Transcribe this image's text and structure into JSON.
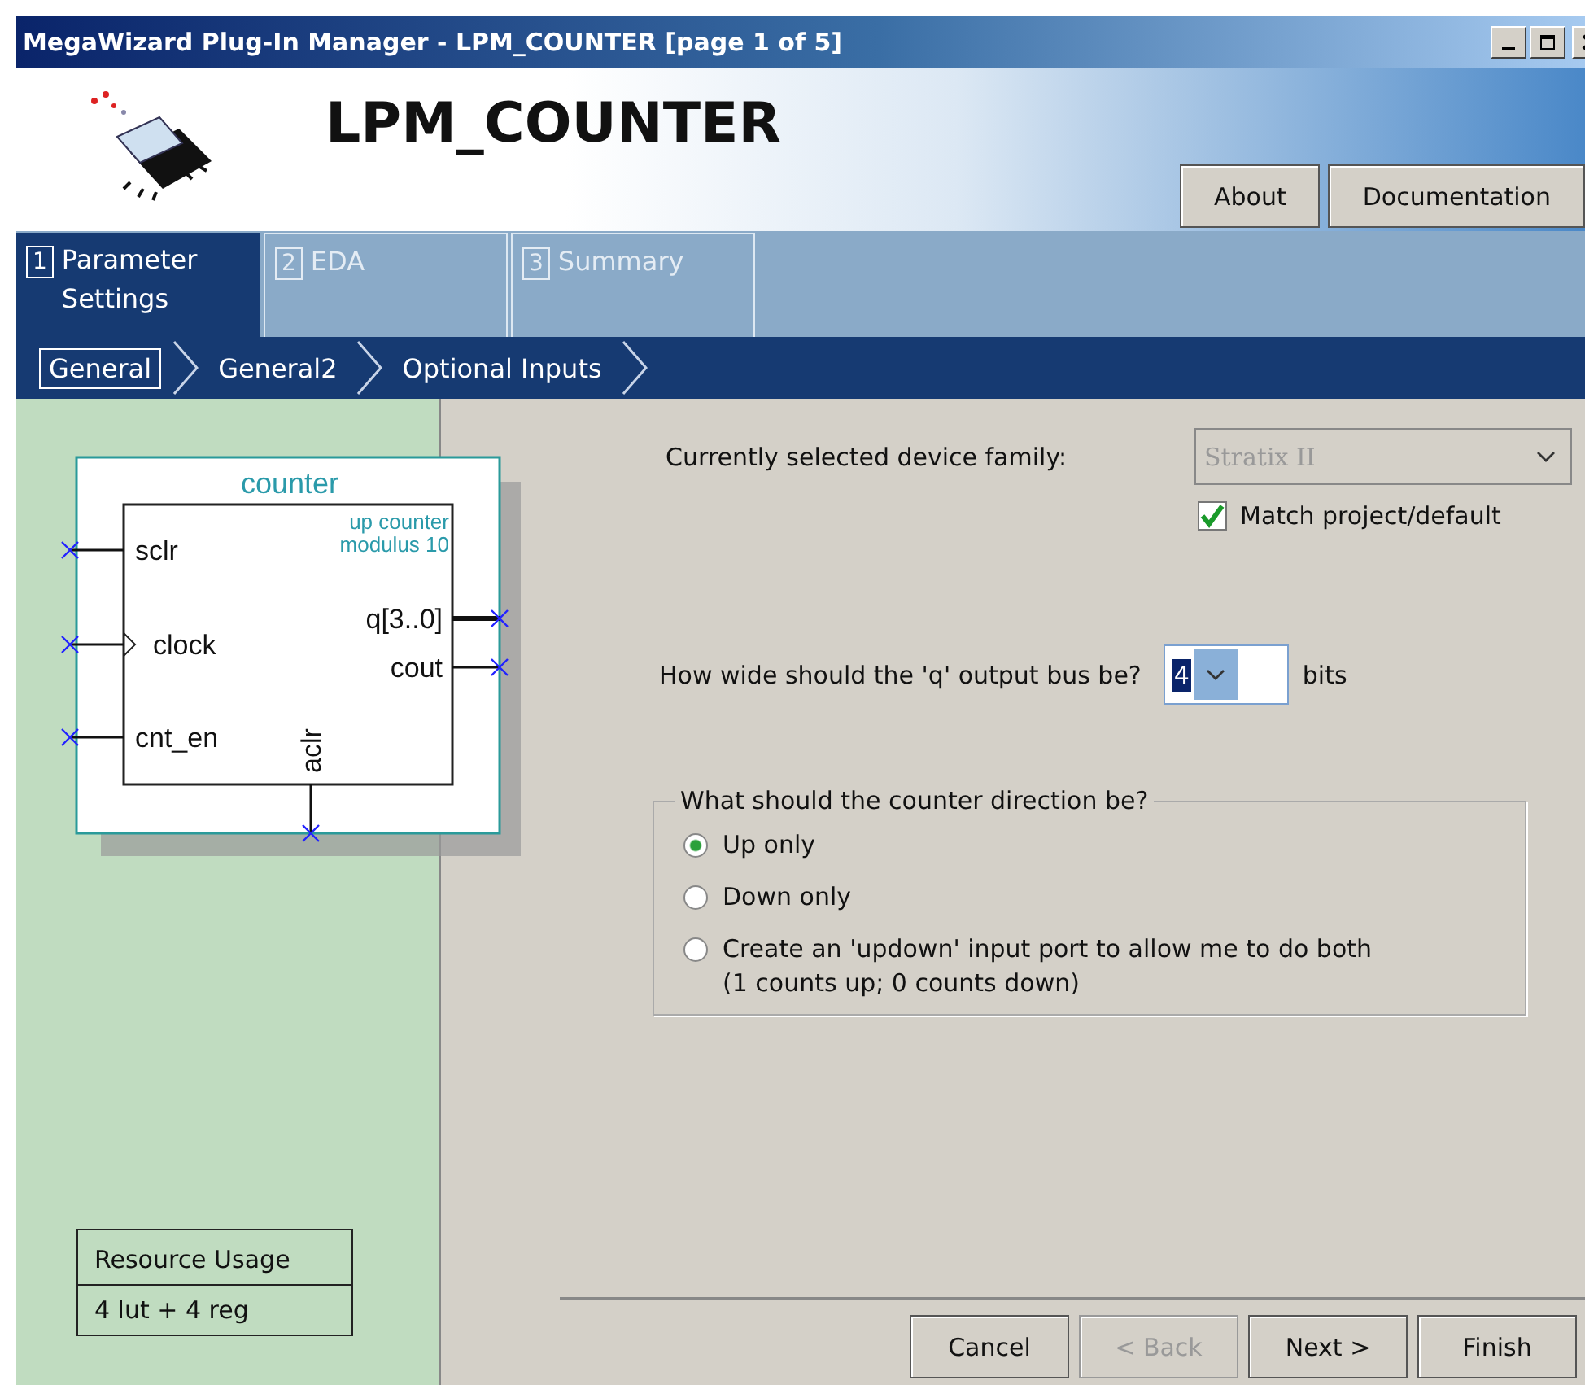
{
  "window": {
    "title": "MegaWizard Plug-In Manager - LPM_COUNTER [page 1 of 5]"
  },
  "header": {
    "title": "LPM_COUNTER",
    "buttons": [
      "About",
      "Documentation"
    ]
  },
  "tabs": [
    {
      "number": "1",
      "label": "Parameter Settings",
      "selected": true
    },
    {
      "number": "2",
      "label": "EDA",
      "selected": false
    },
    {
      "number": "3",
      "label": "Summary",
      "selected": false
    }
  ],
  "steps": [
    {
      "label": "General",
      "selected": true
    },
    {
      "label": "General2",
      "selected": false
    },
    {
      "label": "Optional Inputs",
      "selected": false
    }
  ],
  "schematic": {
    "title": "counter",
    "notes": [
      "up counter",
      "modulus 10"
    ],
    "inputs": [
      "sclr",
      "clock",
      "cnt_en"
    ],
    "outputs": [
      "q[3..0]",
      "cout"
    ],
    "bottom_port": "aclr"
  },
  "resource_usage": {
    "heading": "Resource Usage",
    "value": "4 lut + 4 reg"
  },
  "device_family": {
    "label": "Currently selected device family:",
    "value": "Stratix II",
    "disabled": true
  },
  "match_project": {
    "label": "Match project/default",
    "checked": true
  },
  "bus_width": {
    "label": "How wide should the 'q' output bus be?",
    "value": "4",
    "unit": "bits"
  },
  "direction": {
    "legend": "What should the counter direction be?",
    "options": [
      {
        "label": "Up only",
        "selected": true
      },
      {
        "label": "Down only",
        "selected": false
      },
      {
        "label": "Create an 'updown' input port to allow me to do both",
        "note": "(1 counts up; 0 counts down)",
        "selected": false
      }
    ]
  },
  "footer_buttons": [
    {
      "label": "Cancel",
      "disabled": false
    },
    {
      "label": "< Back",
      "disabled": true
    },
    {
      "label": "Next >",
      "disabled": false
    },
    {
      "label": "Finish",
      "disabled": false
    }
  ]
}
